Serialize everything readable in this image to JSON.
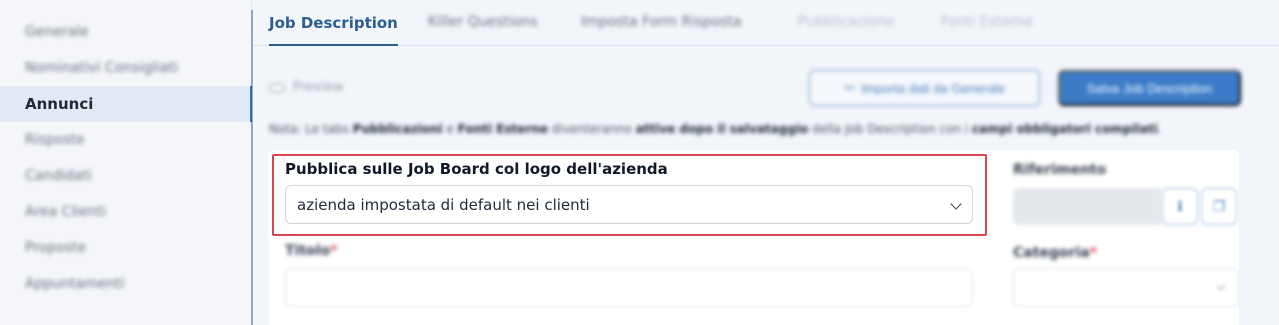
{
  "sidebar": {
    "items": [
      {
        "label": "Generale",
        "state": "blurred"
      },
      {
        "label": "Nominativi Consigliati",
        "state": "blurred"
      },
      {
        "label": "Annunci",
        "state": "active"
      },
      {
        "label": "Risposte",
        "state": "blurred"
      },
      {
        "label": "Candidati",
        "state": "blurred"
      },
      {
        "label": "Area Clienti",
        "state": "blurred"
      },
      {
        "label": "Proposte",
        "state": "blurred"
      },
      {
        "label": "Appuntamenti",
        "state": "blurred"
      }
    ]
  },
  "tabs": [
    {
      "label": "Job Description",
      "state": "active"
    },
    {
      "label": "Killer Questions",
      "state": "blurred"
    },
    {
      "label": "Imposta Form Risposta",
      "state": "blurred"
    },
    {
      "label": "Pubblicazione",
      "state": "disabled"
    },
    {
      "label": "Fonti Esterne",
      "state": "disabled"
    }
  ],
  "toolbar": {
    "preview_label": "Preview",
    "import_label": "Importa dati da Generale",
    "save_label": "Salva Job Description"
  },
  "note": {
    "prefix": "Nota: Le tabs ",
    "tab1": "Pubblicazioni",
    "mid1": " e ",
    "tab2": "Fonti Esterne",
    "mid2": " diventeranno ",
    "bold1": "attive dopo il salvataggio",
    "mid3": " della Job Description con i ",
    "bold2": "campi obbligatori compilati",
    "suffix": "."
  },
  "form": {
    "logo_field": {
      "label": "Pubblica sulle Job Board col logo dell'azienda",
      "value": "azienda impostata di default nei clienti"
    },
    "titolo": {
      "label": "Titolo",
      "required_mark": "*",
      "value": ""
    },
    "riferimento": {
      "label": "Riferimento",
      "value": ""
    },
    "categoria": {
      "label": "Categoria",
      "required_mark": "*",
      "value": ""
    }
  },
  "colors": {
    "accent": "#2c5d93",
    "button_primary": "#3b7bc7",
    "highlight_border": "#d64550",
    "active_sidebar_bg": "#e3e9f2"
  },
  "icons": {
    "preview": "eye-icon",
    "import": "import-icon",
    "info": "info-icon",
    "copy": "copy-icon",
    "select": "chevron-down-icon"
  }
}
